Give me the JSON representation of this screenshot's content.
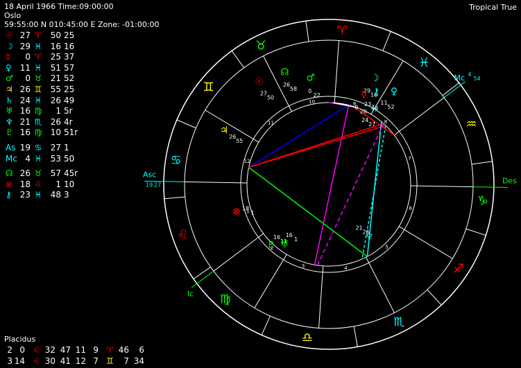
{
  "header": {
    "line1": "18 April 1966 Time:09:00:00",
    "line2": "Oslo",
    "line3": "59:55:00 N 010:45:00 E Zone: -01:00:00",
    "mode": "Tropical True"
  },
  "colors": {
    "red": "#ff0000",
    "green": "#00ff00",
    "cyan": "#00ffff",
    "yellow": "#ffff00",
    "white": "#ffffff",
    "magenta": "#ff00ff",
    "blue": "#0000ff"
  },
  "planets": [
    {
      "glyph": "☉",
      "name": "sun",
      "deg": "27",
      "sign": "♈",
      "min": "50",
      "extra": "25",
      "color": "#ff0000",
      "signColor": "#ff0000"
    },
    {
      "glyph": "☽",
      "name": "moon",
      "deg": "29",
      "sign": "♓",
      "min": "16",
      "extra": "16",
      "color": "#00ffff",
      "signColor": "#00ffff"
    },
    {
      "glyph": "☿",
      "name": "mercury",
      "deg": "0",
      "sign": "♈",
      "min": "25",
      "extra": "37",
      "color": "#ff0000",
      "signColor": "#ff0000"
    },
    {
      "glyph": "♀",
      "name": "venus",
      "deg": "11",
      "sign": "♓",
      "min": "51",
      "extra": "57",
      "color": "#00ffff",
      "signColor": "#00ffff"
    },
    {
      "glyph": "♂",
      "name": "mars",
      "deg": "0",
      "sign": "♉",
      "min": "21",
      "extra": "52",
      "color": "#00ff00",
      "signColor": "#00ff00"
    },
    {
      "glyph": "♃",
      "name": "jupiter",
      "deg": "26",
      "sign": "♊",
      "min": "55",
      "extra": "25",
      "color": "#ffff00",
      "signColor": "#ffff00"
    },
    {
      "glyph": "♄",
      "name": "saturn",
      "deg": "24",
      "sign": "♓",
      "min": "26",
      "extra": "49",
      "color": "#00ffff",
      "signColor": "#00ffff"
    },
    {
      "glyph": "♅",
      "name": "uranus",
      "deg": "16",
      "sign": "♍",
      "min": "1",
      "extra": "5r",
      "color": "#00ff00",
      "signColor": "#00ff00"
    },
    {
      "glyph": "♆",
      "name": "neptune",
      "deg": "21",
      "sign": "♏",
      "min": "26",
      "extra": "4r",
      "color": "#00ffff",
      "signColor": "#00ffff"
    },
    {
      "glyph": "♇",
      "name": "pluto",
      "deg": "16",
      "sign": "♍",
      "min": "10",
      "extra": "51r",
      "color": "#00ff00",
      "signColor": "#00ff00"
    }
  ],
  "angles": [
    {
      "glyph": "As",
      "name": "ascendant",
      "deg": "19",
      "sign": "♋",
      "min": "27",
      "extra": "1",
      "color": "#00ffff",
      "signColor": "#00ffff"
    },
    {
      "glyph": "Mc",
      "name": "midheaven",
      "deg": "4",
      "sign": "♓",
      "min": "53",
      "extra": "50",
      "color": "#00ffff",
      "signColor": "#00ffff"
    }
  ],
  "points": [
    {
      "glyph": "☊",
      "name": "node",
      "deg": "26",
      "sign": "♉",
      "min": "57",
      "extra": "45r",
      "color": "#00ff00",
      "signColor": "#00ff00"
    },
    {
      "glyph": "⊗",
      "name": "fortune",
      "deg": "18",
      "sign": "♌",
      "min": "1",
      "extra": "10",
      "color": "#ff0000",
      "signColor": "#ff0000"
    },
    {
      "glyph": "⚷",
      "name": "chiron",
      "deg": "23",
      "sign": "♓",
      "min": "48",
      "extra": "3",
      "color": "#00ffff",
      "signColor": "#00ffff"
    }
  ],
  "house_system": "Placidus",
  "cusps": [
    [
      {
        "v": "2",
        "c": "#ffffff"
      },
      {
        "v": "0",
        "c": "#ffffff"
      },
      {
        "v": "♌",
        "c": "#ff0000"
      },
      {
        "v": "32",
        "c": "#ffffff"
      },
      {
        "v": "47",
        "c": "#ffffff"
      },
      {
        "v": "11",
        "c": "#ffffff"
      },
      {
        "v": "9",
        "c": "#ffffff"
      },
      {
        "v": "♈",
        "c": "#ff0000"
      },
      {
        "v": "46",
        "c": "#ffffff"
      },
      {
        "v": "6",
        "c": "#ffffff"
      }
    ],
    [
      {
        "v": "3",
        "c": "#ffffff"
      },
      {
        "v": "14",
        "c": "#ffffff"
      },
      {
        "v": "♌",
        "c": "#ff0000"
      },
      {
        "v": "30",
        "c": "#ffffff"
      },
      {
        "v": "41",
        "c": "#ffffff"
      },
      {
        "v": "12",
        "c": "#ffffff"
      },
      {
        "v": "7",
        "c": "#ffffff"
      },
      {
        "v": "♊",
        "c": "#ffff00"
      },
      {
        "v": "7",
        "c": "#ffffff"
      },
      {
        "v": "34",
        "c": "#ffffff"
      }
    ]
  ],
  "wheel": {
    "signs": [
      {
        "g": "♈",
        "c": "#ff0000",
        "name": "aries"
      },
      {
        "g": "♉",
        "c": "#00ff00",
        "name": "taurus"
      },
      {
        "g": "♊",
        "c": "#ffff00",
        "name": "gemini"
      },
      {
        "g": "♋",
        "c": "#00ffff",
        "name": "cancer"
      },
      {
        "g": "♌",
        "c": "#ff0000",
        "name": "leo"
      },
      {
        "g": "♍",
        "c": "#00ff00",
        "name": "virgo"
      },
      {
        "g": "♎",
        "c": "#ffff00",
        "name": "libra"
      },
      {
        "g": "♏",
        "c": "#00ffff",
        "name": "scorpio"
      },
      {
        "g": "♐",
        "c": "#ff0000",
        "name": "sagittarius"
      },
      {
        "g": "♑",
        "c": "#00ff00",
        "name": "capricorn"
      },
      {
        "g": "♒",
        "c": "#ffff00",
        "name": "aquarius"
      },
      {
        "g": "♓",
        "c": "#00ffff",
        "name": "pisces"
      }
    ],
    "asc_label": "Asc",
    "asc_deg": "19",
    "asc_min": "27",
    "des_label": "Des",
    "mc_label": "Mc",
    "mc_deg": "4",
    "mc_min": "54",
    "ic_label": "Ic",
    "house_numbers": [
      "1",
      "2",
      "3",
      "4",
      "5",
      "6",
      "7",
      "8",
      "9",
      "10",
      "11",
      "12"
    ],
    "chart_planets": [
      {
        "g": "☉",
        "c": "#ff0000",
        "deg": "27",
        "min": "50"
      },
      {
        "g": "☊",
        "c": "#00ff00",
        "deg": "26",
        "min": "58"
      },
      {
        "g": "♂",
        "c": "#00ff00",
        "deg": "0",
        "min": "22"
      },
      {
        "g": "☽",
        "c": "#00ffff",
        "deg": "29",
        "min": "16"
      },
      {
        "g": "⚷",
        "c": "#00ffff",
        "deg": "23",
        "min": "48"
      },
      {
        "g": "♀",
        "c": "#00ffff",
        "deg": "11",
        "min": "52"
      },
      {
        "g": "☿",
        "c": "#ff0000",
        "deg": "0",
        "min": "26"
      },
      {
        "g": "♄",
        "c": "#00ffff",
        "deg": "24",
        "min": "27"
      },
      {
        "g": "♃",
        "c": "#ffff00",
        "deg": "26",
        "min": "55"
      },
      {
        "g": "⊗",
        "c": "#ff0000",
        "deg": "18",
        "min": "1"
      },
      {
        "g": "♇",
        "c": "#00ff00",
        "deg": "16",
        "min": "11"
      },
      {
        "g": "♅",
        "c": "#00ff00",
        "deg": "16",
        "min": "1"
      },
      {
        "g": "♆",
        "c": "#00ffff",
        "deg": "21",
        "min": "26"
      }
    ]
  }
}
